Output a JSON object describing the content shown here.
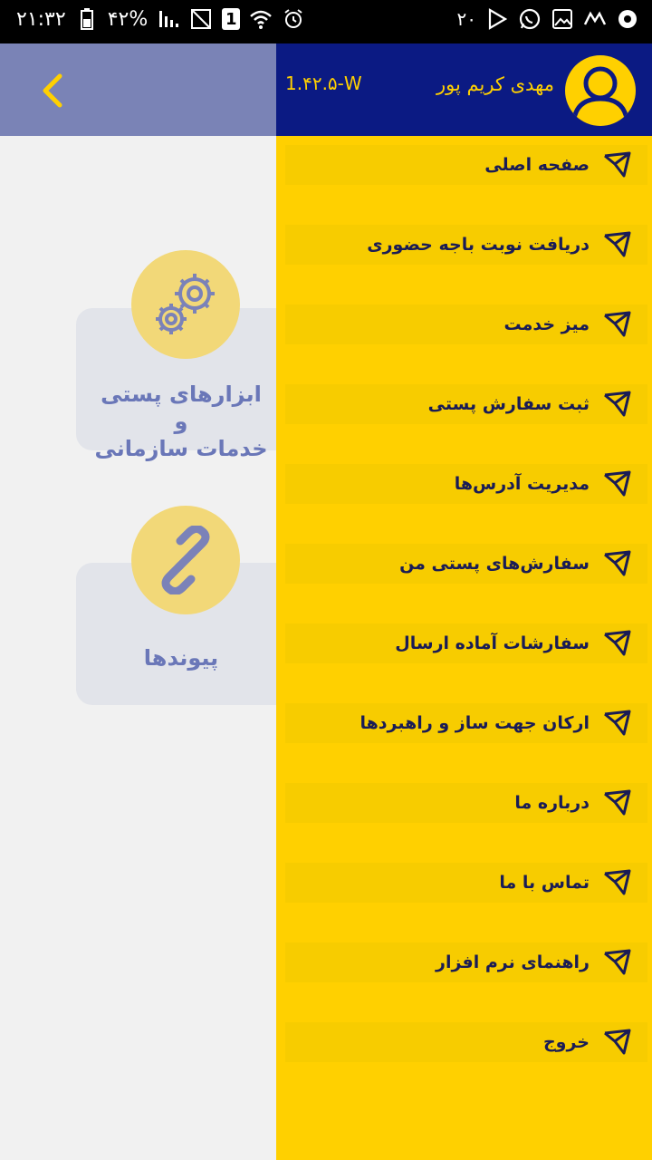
{
  "status_bar": {
    "time": "۲۱:۳۲",
    "battery": "۴۲%",
    "sim_badge": "1",
    "notification_count": "۲۰"
  },
  "main": {
    "cards": [
      {
        "label_line1": "ابزارهای پستی و",
        "label_line2": "خدمات سازمانی",
        "icon": "gears-icon"
      },
      {
        "label": "پیوندها",
        "icon": "link-icon"
      }
    ]
  },
  "drawer": {
    "user_name": "مهدی کریم پور",
    "version": "1.۴۲.۵-W",
    "menu": [
      {
        "label": "صفحه اصلی"
      },
      {
        "label": "دریافت نوبت باجه حضوری"
      },
      {
        "label": "میز خدمت"
      },
      {
        "label": "ثبت سفارش پستی"
      },
      {
        "label": "مدیریت آدرس‌ها"
      },
      {
        "label": "سفارش‌های پستی من"
      },
      {
        "label": "سفارشات آماده ارسال"
      },
      {
        "label": "ارکان جهت ساز و راهبردها"
      },
      {
        "label": "درباره ما"
      },
      {
        "label": "تماس با ما"
      },
      {
        "label": "راهنمای نرم افزار"
      },
      {
        "label": "خروج"
      }
    ]
  },
  "colors": {
    "drawer_bg": "#ffd000",
    "drawer_header": "#0b1a83",
    "topbar": "#7a83b6",
    "menu_text": "#1a1c55",
    "card_text": "#6a77b8"
  }
}
